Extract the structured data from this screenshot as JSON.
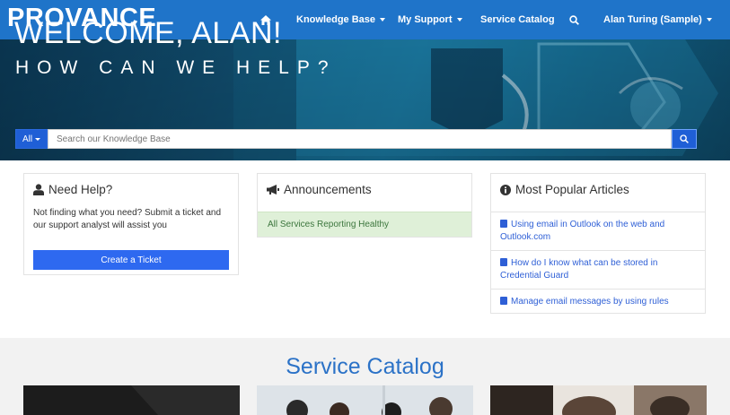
{
  "brand": {
    "logo_text": "PROVANCE",
    "color": "#1f74c9"
  },
  "nav": {
    "home_icon": "home-icon",
    "knowledge_base": "Knowledge Base",
    "my_support": "My Support",
    "service_catalog": "Service Catalog",
    "search_icon": "search-icon",
    "user": "Alan Turing (Sample)"
  },
  "hero": {
    "welcome": "WELCOME, ALAN!",
    "tagline": "HOW CAN WE HELP?",
    "search": {
      "filter": "All",
      "placeholder": "Search our Knowledge Base"
    }
  },
  "panels": {
    "help": {
      "title": "Need Help?",
      "icon": "user-icon",
      "text": "Not finding what you need? Submit a ticket and our support analyst will assist you",
      "button": "Create a Ticket"
    },
    "announcements": {
      "title": "Announcements",
      "icon": "bullhorn-icon",
      "items": [
        "All Services Reporting Healthy"
      ]
    },
    "popular": {
      "title": "Most Popular Articles",
      "icon": "info-icon",
      "articles": [
        "Using email in Outlook on the web and Outlook.com",
        "How do I know what can be stored in Credential Guard",
        "Manage email messages by using rules"
      ]
    }
  },
  "catalog": {
    "title": "Service Catalog"
  },
  "colors": {
    "accent": "#2e69f0",
    "link": "#2e5fd6",
    "success_bg": "#dff0d8",
    "catalog_title": "#2b72c7"
  }
}
